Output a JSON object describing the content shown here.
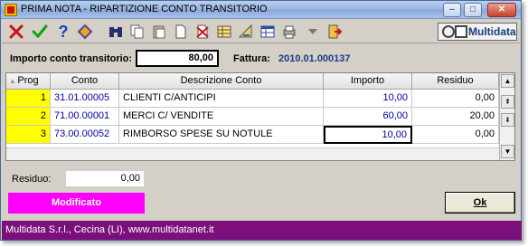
{
  "window": {
    "title": "PRIMA NOTA - RIPARTIZIONE CONTO TRANSITORIO",
    "minimize": "–",
    "maximize": "□",
    "close": "✕"
  },
  "toolbar": {
    "icons": [
      "close-x-icon",
      "confirm-check-icon",
      "help-icon",
      "book-icon",
      "binoculars-icon",
      "copy-icon",
      "paste-icon",
      "new-page-icon",
      "delete-page-icon",
      "table-icon",
      "calculator-icon",
      "grid-icon",
      "print-icon",
      "dropdown-arrow-icon",
      "exit-icon"
    ],
    "logo_text": "Multidata"
  },
  "header": {
    "transit_label": "Importo conto transitorio:",
    "transit_value": "80,00",
    "fattura_label": "Fattura:",
    "fattura_value": "2010.01.000137"
  },
  "grid": {
    "columns": [
      "Prog",
      "Conto",
      "Descrizione Conto",
      "Importo",
      "Residuo"
    ],
    "rows": [
      {
        "prog": "1",
        "conto": "31.01.00005",
        "desc": "CLIENTI C/ANTICIPI",
        "importo": "10,00",
        "residuo": "0,00"
      },
      {
        "prog": "2",
        "conto": "71.00.00001",
        "desc": "MERCI C/ VENDITE",
        "importo": "60,00",
        "residuo": "20,00"
      },
      {
        "prog": "3",
        "conto": "73.00.00052",
        "desc": "RIMBORSO SPESE SU NOTULE",
        "importo": "10,00",
        "residuo": "0,00"
      }
    ]
  },
  "footer": {
    "residuo_label": "Residuo:",
    "residuo_value": "0,00",
    "status_badge": "Modificato",
    "ok_label": "Ok",
    "status_text": "Multidata S.r.l., Cecina (LI), www.multidatanet.it"
  },
  "colors": {
    "prog_cell": "#ffff00",
    "badge": "#ff00ff",
    "statusbar": "#7b0f7b",
    "value_text": "#0000a0"
  }
}
